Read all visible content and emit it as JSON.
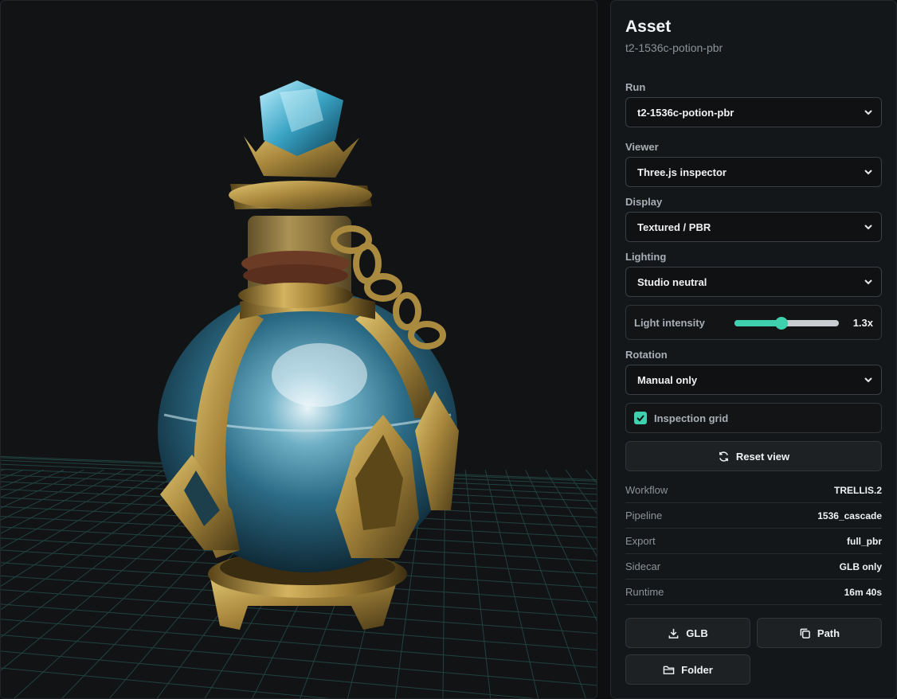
{
  "asset": {
    "title": "Asset",
    "subtitle": "t2-1536c-potion-pbr"
  },
  "controls": {
    "run": {
      "label": "Run",
      "value": "t2-1536c-potion-pbr"
    },
    "viewer": {
      "label": "Viewer",
      "value": "Three.js inspector"
    },
    "display": {
      "label": "Display",
      "value": "Textured / PBR"
    },
    "lighting": {
      "label": "Lighting",
      "value": "Studio neutral"
    },
    "light_intensity": {
      "label": "Light intensity",
      "value_text": "1.3x",
      "fraction": 0.45
    },
    "rotation": {
      "label": "Rotation",
      "value": "Manual only"
    },
    "inspection_grid": {
      "label": "Inspection grid",
      "checked": true
    },
    "reset_view": {
      "label": "Reset view"
    }
  },
  "info": [
    {
      "key": "Workflow",
      "value": "TRELLIS.2"
    },
    {
      "key": "Pipeline",
      "value": "1536_cascade"
    },
    {
      "key": "Export",
      "value": "full_pbr"
    },
    {
      "key": "Sidecar",
      "value": "GLB only"
    },
    {
      "key": "Runtime",
      "value": "16m 40s"
    }
  ],
  "actions": {
    "glb": "GLB",
    "path": "Path",
    "folder": "Folder"
  },
  "colors": {
    "accent": "#3fd0ad",
    "background": "#111315",
    "panel": "#141719"
  },
  "icons": {
    "reset": "refresh-icon",
    "glb": "download-icon",
    "path": "copy-icon",
    "folder": "folder-icon"
  }
}
